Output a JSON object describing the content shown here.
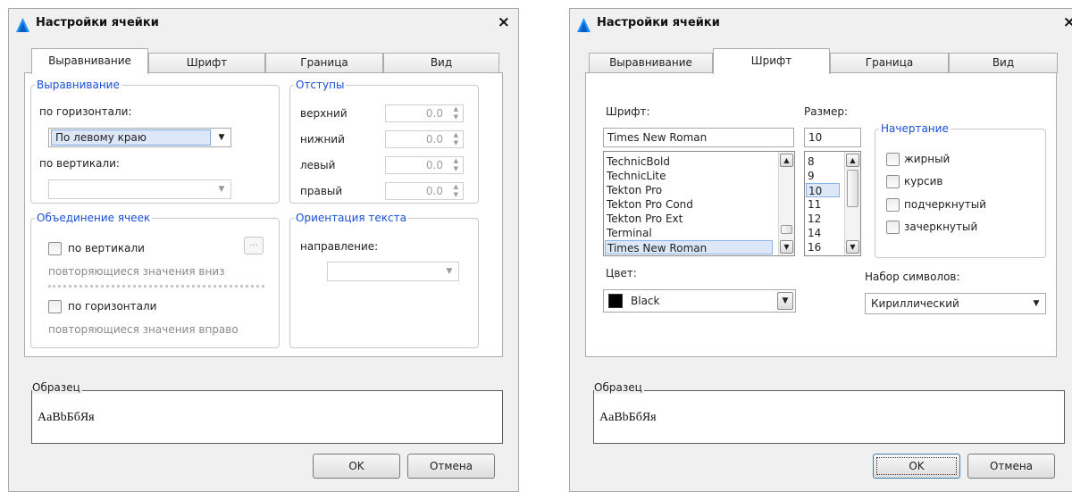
{
  "left_dialog": {
    "title": "Настройки ячейки",
    "close_glyph": "×",
    "tabs": [
      "Выравнивание",
      "Шрифт",
      "Граница",
      "Вид"
    ],
    "active_tab": "Выравнивание",
    "alignment": {
      "legend": "Выравнивание",
      "horizontal_label": "по горизонтали:",
      "horizontal_value": "По левому краю",
      "vertical_label": "по вертикали:",
      "vertical_value": ""
    },
    "indents": {
      "legend": "Отступы",
      "rows": [
        {
          "label": "верхний",
          "value": "0.0"
        },
        {
          "label": "нижний",
          "value": "0.0"
        },
        {
          "label": "левый",
          "value": "0.0"
        },
        {
          "label": "правый",
          "value": "0.0"
        }
      ]
    },
    "merge": {
      "legend": "Объединение ячеек",
      "vertical_label": "по вертикали",
      "vertical_checked": false,
      "vertical_hint": "повторяющиеся значения вниз",
      "more_glyph": "...",
      "horizontal_label": "по горизонтали",
      "horizontal_checked": false,
      "horizontal_hint": "повторяющиеся значения вправо"
    },
    "orientation": {
      "legend": "Ориентация текста",
      "direction_label": "направление:",
      "direction_value": ""
    },
    "sample": {
      "legend": "Образец",
      "text": "AaBbБбЯя"
    },
    "ok_label": "OK",
    "cancel_label": "Отмена"
  },
  "right_dialog": {
    "title": "Настройки ячейки",
    "close_glyph": "×",
    "tabs": [
      "Выравнивание",
      "Шрифт",
      "Граница",
      "Вид"
    ],
    "active_tab": "Шрифт",
    "font_label": "Шрифт:",
    "font_value": "Times New Roman",
    "font_list": [
      "TechnicBold",
      "TechnicLite",
      "Tekton Pro",
      "Tekton Pro Cond",
      "Tekton Pro Ext",
      "Terminal",
      "Times New Roman"
    ],
    "font_selected": "Times New Roman",
    "size_label": "Размер:",
    "size_value": "10",
    "size_list": [
      "8",
      "9",
      "10",
      "11",
      "12",
      "14",
      "16"
    ],
    "size_selected": "10",
    "style": {
      "legend": "Начертание",
      "options": [
        {
          "label": "жирный",
          "checked": false
        },
        {
          "label": "курсив",
          "checked": false
        },
        {
          "label": "подчеркнутый",
          "checked": false
        },
        {
          "label": "зачеркнутый",
          "checked": false
        }
      ]
    },
    "color_label": "Цвет:",
    "color_value": "Black",
    "color_swatch": "#000000",
    "charset_label": "Набор символов:",
    "charset_value": "Кириллический",
    "sample": {
      "legend": "Образец",
      "text": "AaBbБбЯя"
    },
    "ok_label": "OK",
    "cancel_label": "Отмена"
  },
  "colors": {
    "legend_blue": "#1a4fd6",
    "selection_bg": "#dce8f8",
    "app_icon_blue": "#1e90ff"
  }
}
